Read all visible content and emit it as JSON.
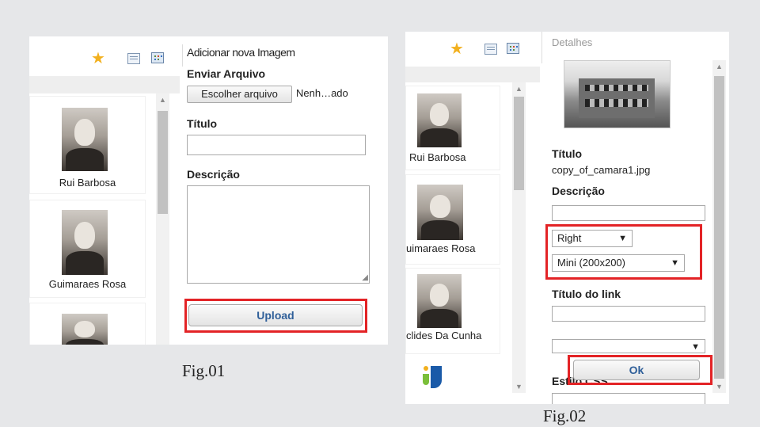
{
  "fig1": {
    "caption": "Fig.01",
    "sidebar": [
      "Rui Barbosa",
      "Guimaraes Rosa"
    ],
    "form": {
      "heading": "Adicionar nova Imagem",
      "upload_label": "Enviar Arquivo",
      "choose_button": "Escolher arquivo",
      "file_status": "Nenh…ado",
      "title_label": "Título",
      "title_value": "",
      "description_label": "Descrição",
      "description_value": "",
      "upload_button": "Upload"
    }
  },
  "fig2": {
    "caption": "Fig.02",
    "sidebar": [
      "Rui Barbosa",
      "uimaraes Rosa",
      "clides Da Cunha"
    ],
    "details": {
      "heading": "Detalhes",
      "title_label": "Título",
      "filename": "copy_of_camara1.jpg",
      "description_label": "Descrição",
      "align_select": "Right",
      "size_select": "Mini (200x200)",
      "link_title_label": "Título do link",
      "link_select": "",
      "css_label": "Estilo CSS",
      "ok_button": "Ok"
    }
  },
  "colors": {
    "highlight": "#e32326",
    "star": "#f2b01e"
  }
}
